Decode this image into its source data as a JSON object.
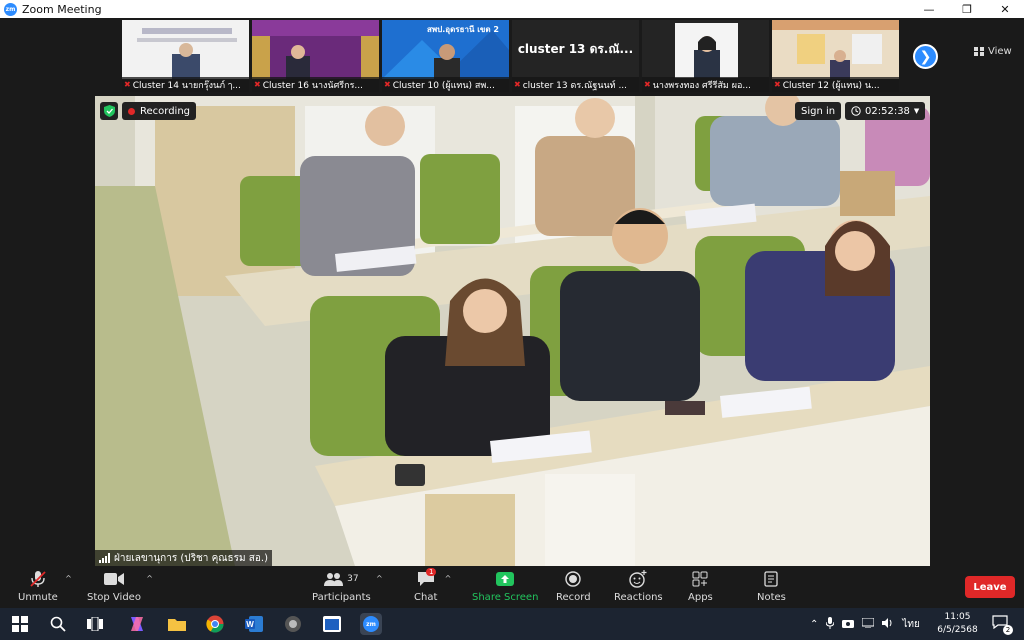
{
  "window": {
    "title": "Zoom Meeting",
    "logo": "zm"
  },
  "thumbnails": [
    {
      "name": "Cluster 14 นายกรุ๊งนภ์ ๅ...",
      "muted": true
    },
    {
      "name": "Cluster 16 นางนัศรีกร...",
      "muted": true
    },
    {
      "name": "Cluster 10 (ผู้แทน) สพ...",
      "muted": true,
      "banner": "สพป.อุดรธานี เขต 2"
    },
    {
      "name": "cluster 13 ดร.ณัฐนนท์ ...",
      "muted": true,
      "big_name": "cluster 13 ดร.ณั..."
    },
    {
      "name": "นางพรงทอง ศรีรีสัม ผอ...",
      "muted": true
    },
    {
      "name": "Cluster 12 (ผู้แทน) น...",
      "muted": true
    }
  ],
  "view_label": "View",
  "main": {
    "recording_label": "Recording",
    "signin_label": "Sign in",
    "timer": "02:52:38",
    "speaker_name": "ฝ่ายเลขานุการ (ปริชา คุณธรม สอ.)"
  },
  "toolbar": {
    "unmute": "Unmute",
    "stop_video": "Stop Video",
    "participants": "Participants",
    "participants_count": "37",
    "chat": "Chat",
    "chat_badge": "1",
    "share_screen": "Share Screen",
    "record": "Record",
    "reactions": "Reactions",
    "apps": "Apps",
    "notes": "Notes",
    "leave": "Leave"
  },
  "taskbar": {
    "lang": "ไทย",
    "time": "11:05",
    "date": "6/5/2568",
    "notifications": "2"
  },
  "colors": {
    "accent": "#2d8cff",
    "leave": "#e02828",
    "share": "#22c55e"
  }
}
